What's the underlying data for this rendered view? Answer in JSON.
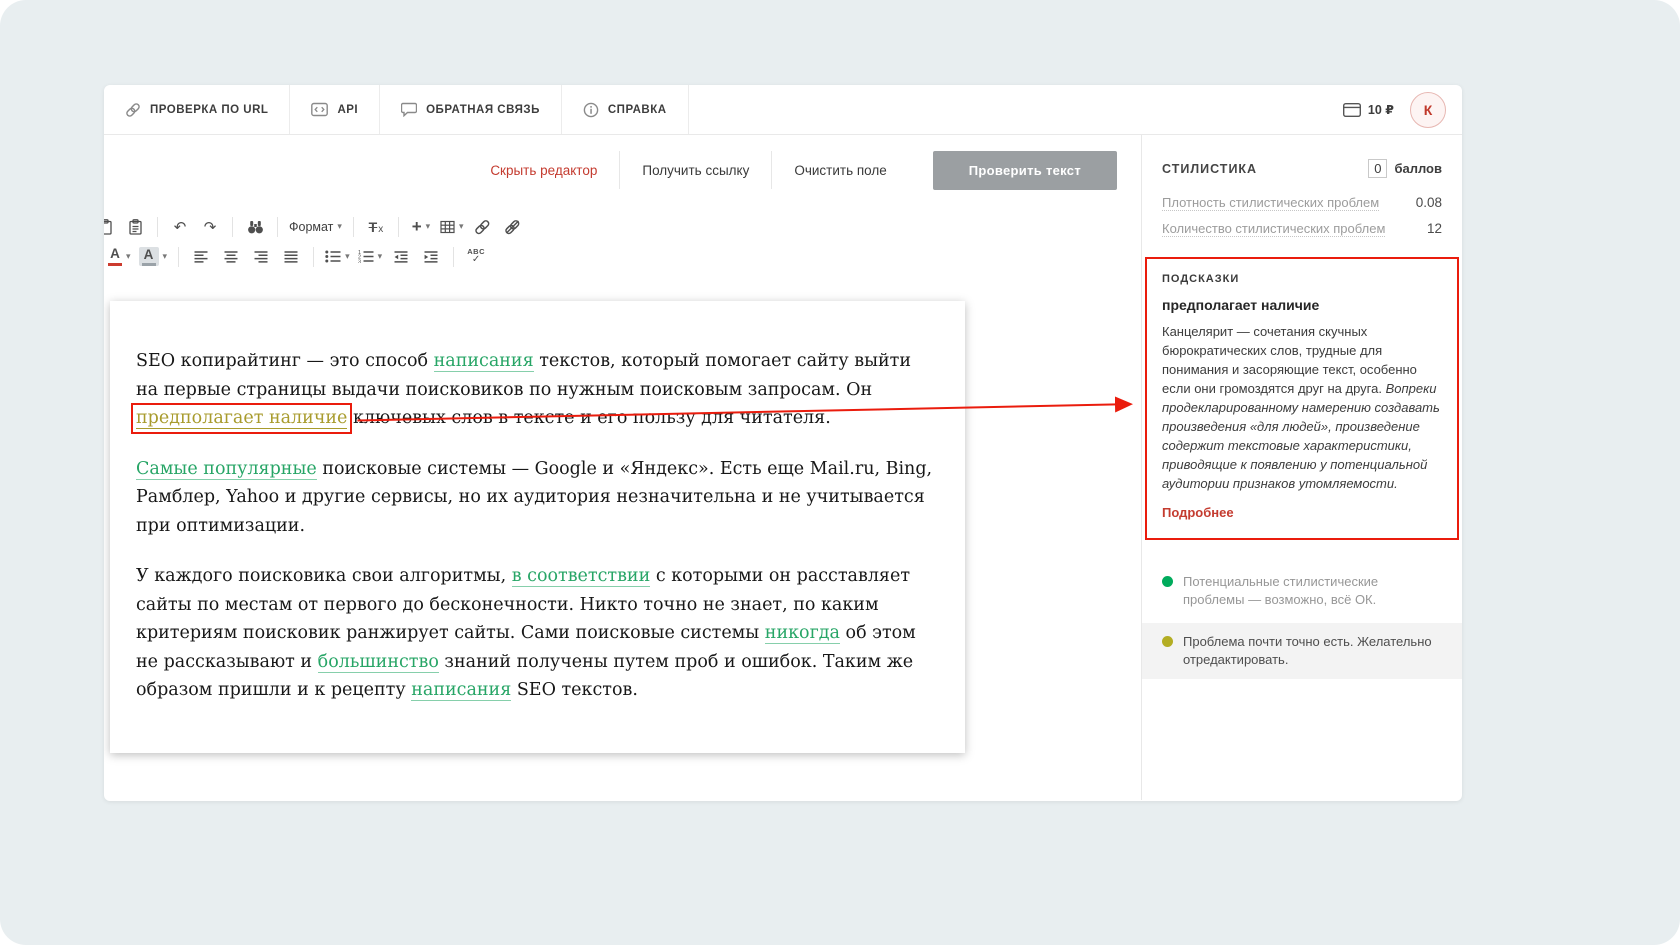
{
  "app": {
    "background": "#e8eef0",
    "accent_red": "#c43b2f",
    "annotation_red": "#ea1c0d"
  },
  "topnav": {
    "tabs": [
      {
        "label": "ПРОВЕРКА ПО URL",
        "icon": "link-icon"
      },
      {
        "label": "API",
        "icon": "api-icon"
      },
      {
        "label": "ОБРАТНАЯ СВЯЗЬ",
        "icon": "feedback-icon"
      },
      {
        "label": "СПРАВКА",
        "icon": "help-icon"
      }
    ],
    "balance": "10 ₽",
    "avatar_initial": "К"
  },
  "actions": {
    "hide_editor": "Скрыть редактор",
    "get_link": "Получить ссылку",
    "clear_field": "Очистить поле",
    "check_text": "Проверить текст"
  },
  "toolbar": {
    "format_label": "Формат",
    "icons": {
      "undo": "↶",
      "redo": "↷",
      "caret": "▾",
      "plus": "+",
      "clear_t": "T",
      "clear_x": "x",
      "color_a": "A",
      "spell_abc": "ABC",
      "spell_check": "✓"
    }
  },
  "document": {
    "paragraphs": [
      [
        {
          "t": "SEO копирайтинг — это способ ",
          "s": "n"
        },
        {
          "t": "написания",
          "s": "g"
        },
        {
          "t": " текстов, который помогает сайту выйти на первые страницы выдачи поисковиков по нужным поисковым запросам. Он ",
          "s": "n"
        },
        {
          "t": "предполагает наличие",
          "s": "y"
        },
        {
          "t": " ключевых слов в тексте и его пользу для читателя.",
          "s": "n"
        }
      ],
      [
        {
          "t": "Самые популярные",
          "s": "g"
        },
        {
          "t": " поисковые системы — Google и «Яндекс». Есть еще Mail.ru, Bing, Рамблер, Yahoo и другие сервисы, но их аудитория незначительна и не учитывается при оптимизации.",
          "s": "n"
        }
      ],
      [
        {
          "t": "У каждого поисковика свои алгоритмы, ",
          "s": "n"
        },
        {
          "t": "в соответствии",
          "s": "g"
        },
        {
          "t": " с которыми он расставляет сайты по местам от первого до бесконечности. Никто точно не знает, по каким критериям поисковик ранжирует сайты. Сами поисковые системы ",
          "s": "n"
        },
        {
          "t": "никогда",
          "s": "g"
        },
        {
          "t": " об этом не рассказывают и ",
          "s": "n"
        },
        {
          "t": "большинство",
          "s": "g"
        },
        {
          "t": " знаний получены путем проб и ошибок. Таким же образом пришли и к рецепту ",
          "s": "n"
        },
        {
          "t": "написания",
          "s": "g"
        },
        {
          "t": " SEO текстов.",
          "s": "n"
        }
      ]
    ]
  },
  "sidebar": {
    "title": "СТИЛИСТИКА",
    "score": {
      "value": "0",
      "unit": "баллов"
    },
    "metrics": [
      {
        "label": "Плотность стилистических проблем",
        "value": "0.08"
      },
      {
        "label": "Количество стилистических проблем",
        "value": "12"
      }
    ],
    "hints": {
      "title": "ПОДСКАЗКИ",
      "term": "предполагает наличие",
      "body": "Канцелярит — сочетания скучных бюрократических слов, трудные для понимания и засоряющие текст, особенно если они громоздятся друг на друга. ",
      "body_italic": "Вопреки продекларированному намерению создавать произведения «для людей», произведение содержит текстовые характеристики, приводящие к появлению у потенциальной аудитории признаков утомляемости.",
      "more_link": "Подробнее"
    },
    "legend": [
      {
        "color": "#00ab5c",
        "text": "Потенциальные стилистические проблемы — возможно, всё ОК.",
        "highlighted": false
      },
      {
        "color": "#b3ad23",
        "text": "Проблема почти точно есть. Желательно отредактировать.",
        "highlighted": true
      }
    ]
  }
}
